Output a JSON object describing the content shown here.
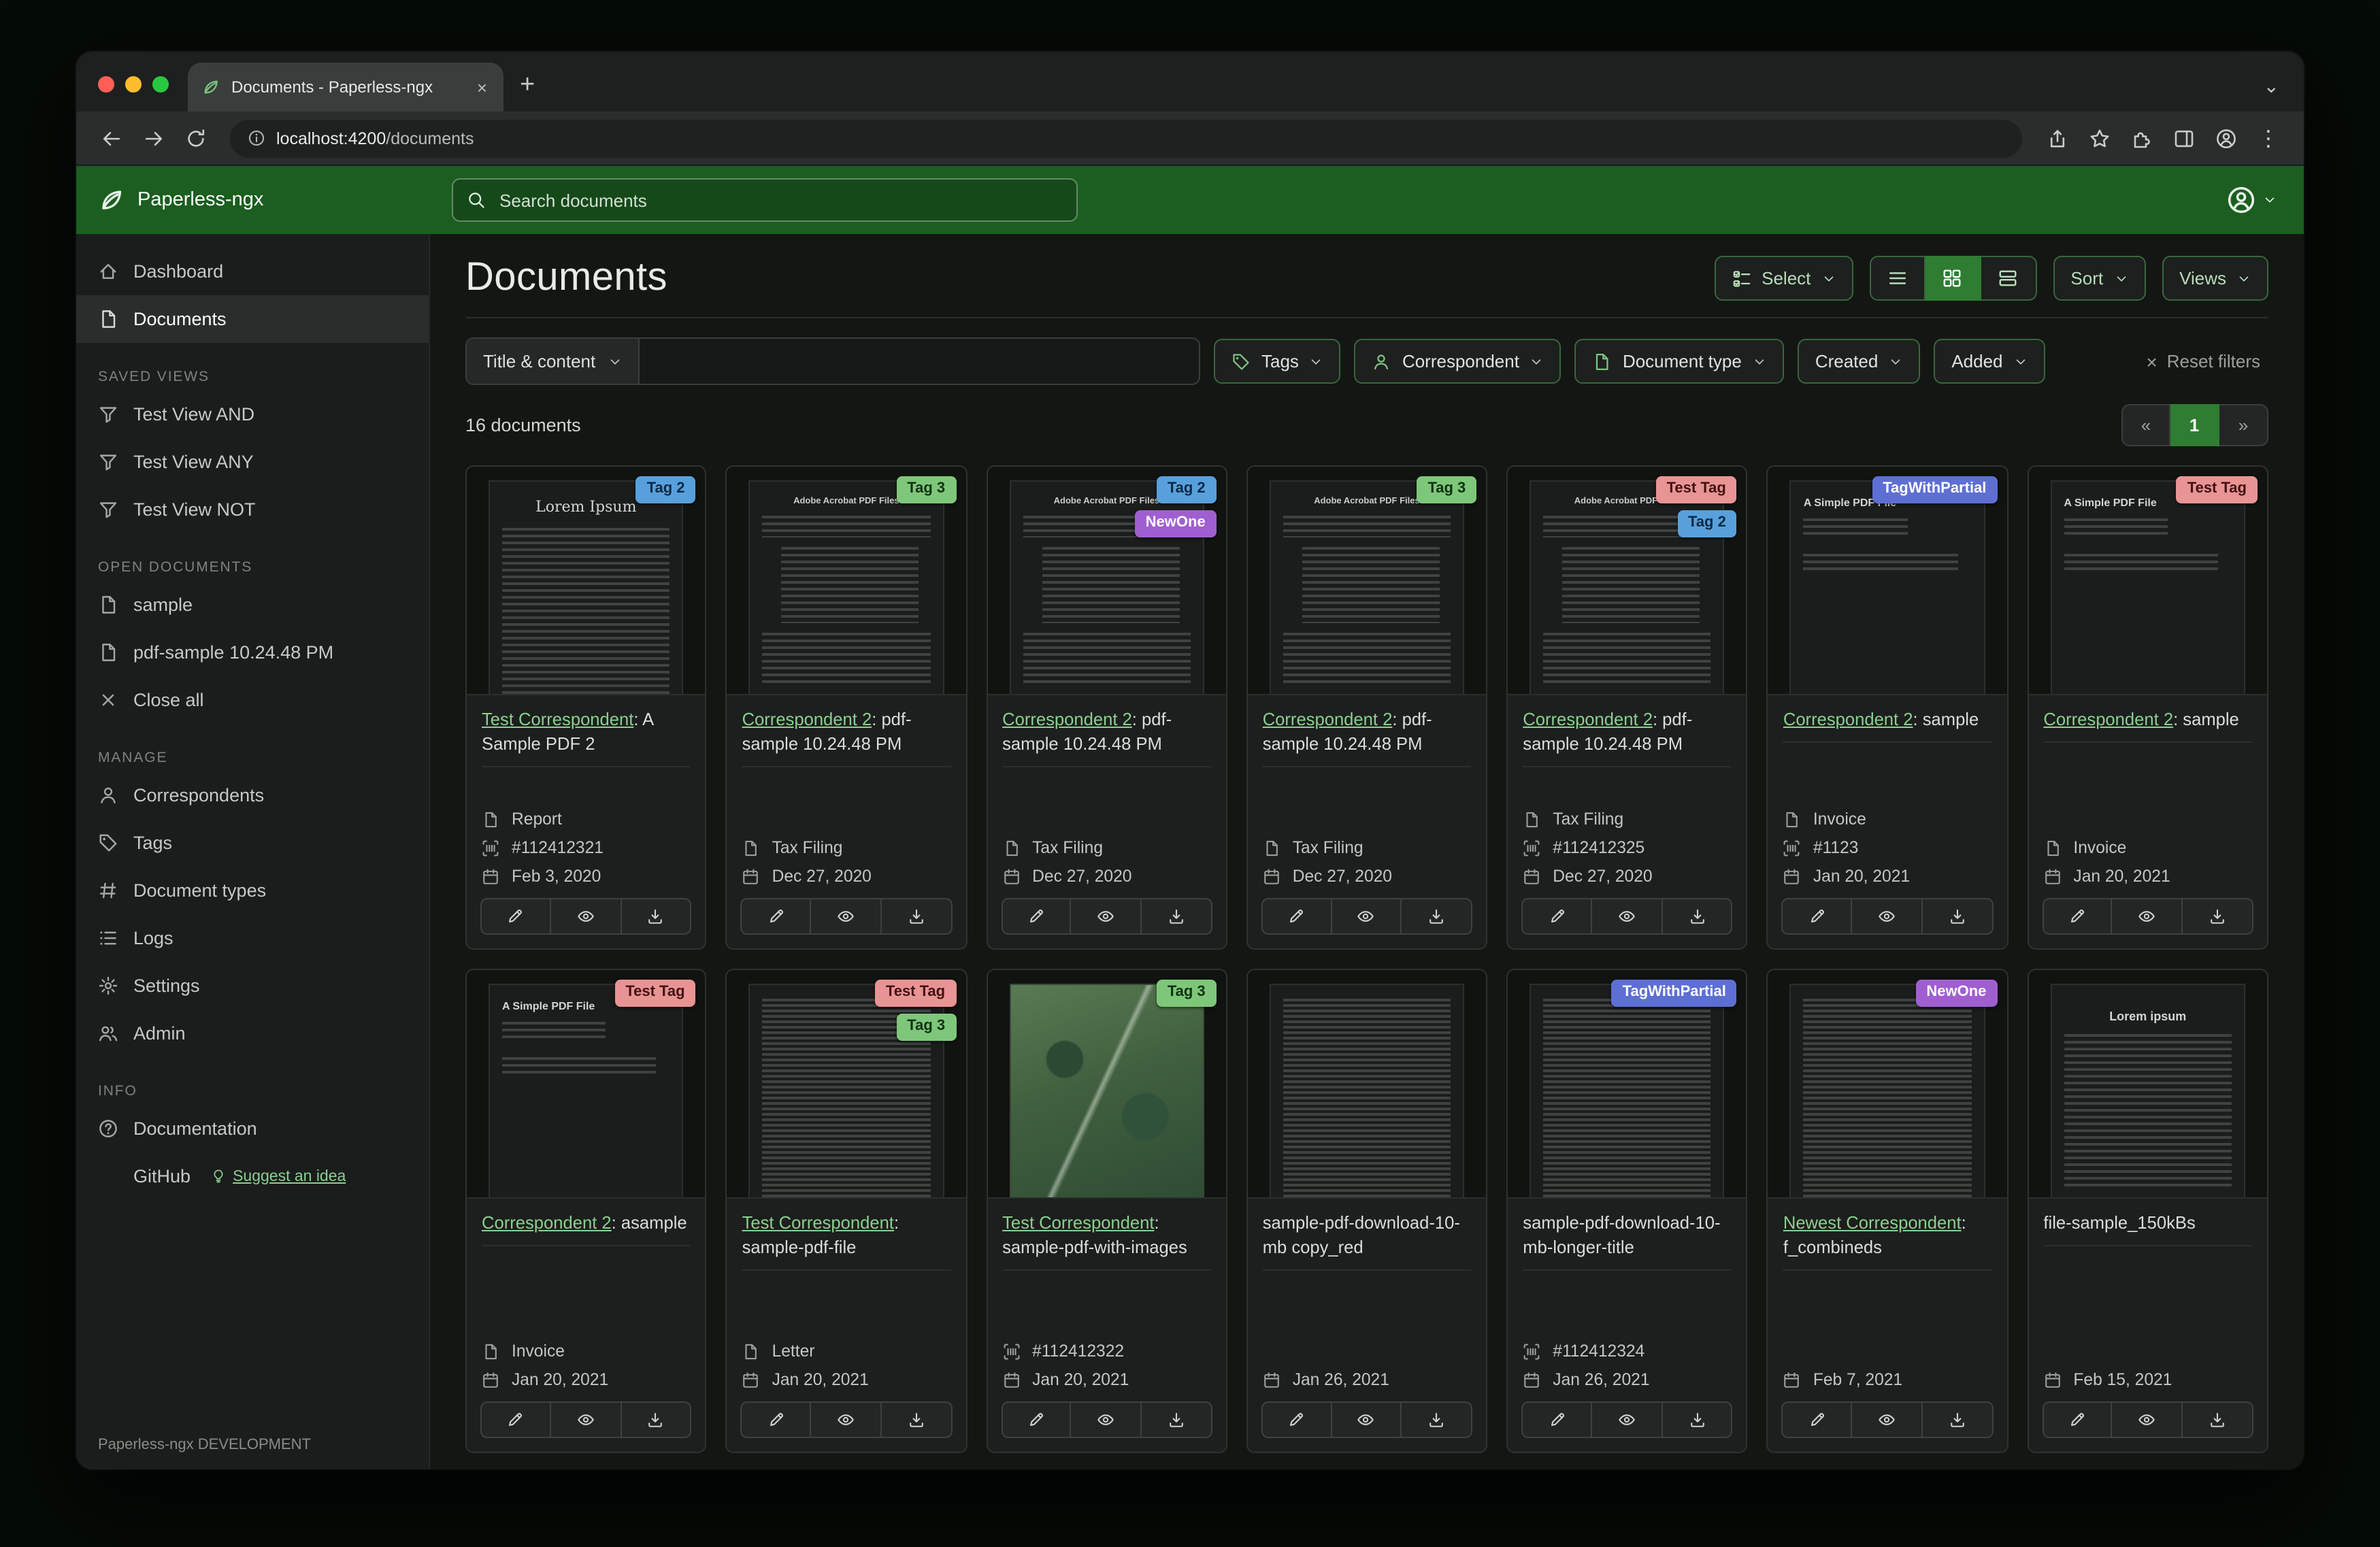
{
  "glyphs": {
    "close": "×",
    "plus": "+",
    "kebab": "⋮",
    "chevron": "⌄"
  },
  "colors": {
    "navbar": "#1b5e20",
    "accent": "#2e7d32",
    "link": "#8ad08f"
  },
  "browser": {
    "tab_title": "Documents - Paperless-ngx",
    "url_host": "localhost:4200",
    "url_path": "/documents"
  },
  "navbar": {
    "brand": "Paperless-ngx",
    "search_placeholder": "Search documents"
  },
  "sidebar": {
    "primary": [
      {
        "label": "Dashboard",
        "icon": "dashboard-icon",
        "active": false
      },
      {
        "label": "Documents",
        "icon": "documents-icon",
        "active": true
      }
    ],
    "sections": [
      {
        "label": "SAVED VIEWS",
        "items": [
          {
            "label": "Test View AND",
            "icon": "filter-icon"
          },
          {
            "label": "Test View ANY",
            "icon": "filter-icon"
          },
          {
            "label": "Test View NOT",
            "icon": "filter-icon"
          }
        ]
      },
      {
        "label": "OPEN DOCUMENTS",
        "items": [
          {
            "label": "sample",
            "icon": "file-icon"
          },
          {
            "label": "pdf-sample 10.24.48 PM",
            "icon": "file-icon"
          },
          {
            "label": "Close all",
            "icon": "close-icon"
          }
        ]
      },
      {
        "label": "MANAGE",
        "items": [
          {
            "label": "Correspondents",
            "icon": "person-icon"
          },
          {
            "label": "Tags",
            "icon": "tag-icon"
          },
          {
            "label": "Document types",
            "icon": "hash-icon"
          },
          {
            "label": "Logs",
            "icon": "logs-icon"
          },
          {
            "label": "Settings",
            "icon": "gear-icon"
          },
          {
            "label": "Admin",
            "icon": "users-icon"
          }
        ]
      },
      {
        "label": "INFO",
        "items": [
          {
            "label": "Documentation",
            "icon": "question-icon"
          },
          {
            "label": "GitHub",
            "icon": "github-icon",
            "extra": "Suggest an idea",
            "extra_icon": "lightbulb-icon"
          }
        ]
      }
    ],
    "footer": "Paperless-ngx DEVELOPMENT"
  },
  "toolbar": {
    "title": "Documents",
    "select_label": "Select",
    "sort_label": "Sort",
    "views_label": "Views"
  },
  "filters": {
    "field_label": "Title & content",
    "input_value": "",
    "buttons": [
      {
        "label": "Tags",
        "icon": "tag-icon"
      },
      {
        "label": "Correspondent",
        "icon": "person-icon"
      },
      {
        "label": "Document type",
        "icon": "file-icon"
      },
      {
        "label": "Created",
        "icon": null
      },
      {
        "label": "Added",
        "icon": null
      }
    ],
    "reset_label": "Reset filters"
  },
  "results": {
    "count_label": "16 documents",
    "pagination": {
      "prev": "«",
      "page": "1",
      "next": "»"
    }
  },
  "tag_colors": {
    "blue": {
      "bg": "#58a0dc",
      "fg": "#0a2a45"
    },
    "green": {
      "bg": "#7ec77a",
      "fg": "#0f3212"
    },
    "red": {
      "bg": "#e89494",
      "fg": "#431111"
    },
    "purple": {
      "bg": "#a05fd0",
      "fg": "#ffffff"
    },
    "indigo": {
      "bg": "#5e6fd3",
      "fg": "#ffffff"
    }
  },
  "cards": [
    {
      "thumb": "lorem",
      "thumb_heading": "Lorem Ipsum",
      "tags": [
        {
          "label": "Tag 2",
          "color": "blue"
        }
      ],
      "link": "Test Correspondent",
      "rest": ": A Sample PDF 2",
      "type": "Report",
      "asn": "#112412321",
      "date": "Feb 3, 2020"
    },
    {
      "thumb": "acrobat",
      "thumb_heading": "Adobe Acrobat PDF Files",
      "tags": [
        {
          "label": "Tag 3",
          "color": "green"
        }
      ],
      "link": "Correspondent 2",
      "rest": ": pdf-sample 10.24.48 PM",
      "type": "Tax Filing",
      "asn": null,
      "date": "Dec 27, 2020"
    },
    {
      "thumb": "acrobat",
      "thumb_heading": "Adobe Acrobat PDF Files",
      "tags": [
        {
          "label": "Tag 2",
          "color": "blue"
        },
        {
          "label": "NewOne",
          "color": "purple"
        }
      ],
      "link": "Correspondent 2",
      "rest": ": pdf-sample 10.24.48 PM",
      "type": "Tax Filing",
      "asn": null,
      "date": "Dec 27, 2020"
    },
    {
      "thumb": "acrobat",
      "thumb_heading": "Adobe Acrobat PDF Files",
      "tags": [
        {
          "label": "Tag 3",
          "color": "green"
        }
      ],
      "link": "Correspondent 2",
      "rest": ": pdf-sample 10.24.48 PM",
      "type": "Tax Filing",
      "asn": null,
      "date": "Dec 27, 2020"
    },
    {
      "thumb": "acrobat",
      "thumb_heading": "Adobe Acrobat PDF Files",
      "tags": [
        {
          "label": "Test Tag",
          "color": "red"
        },
        {
          "label": "Tag 2",
          "color": "blue"
        }
      ],
      "link": "Correspondent 2",
      "rest": ": pdf-sample 10.24.48 PM",
      "type": "Tax Filing",
      "asn": "#112412325",
      "date": "Dec 27, 2020"
    },
    {
      "thumb": "simple",
      "thumb_heading": "A Simple PDF File",
      "tags": [
        {
          "label": "TagWithPartial",
          "color": "indigo"
        }
      ],
      "link": "Correspondent 2",
      "rest": ": sample",
      "type": "Invoice",
      "asn": "#1123",
      "date": "Jan 20, 2021"
    },
    {
      "thumb": "simple",
      "thumb_heading": "A Simple PDF File",
      "tags": [
        {
          "label": "Test Tag",
          "color": "red"
        }
      ],
      "link": "Correspondent 2",
      "rest": ": sample",
      "type": "Invoice",
      "asn": null,
      "date": "Jan 20, 2021"
    },
    {
      "thumb": "simple",
      "thumb_heading": "A Simple PDF File",
      "tags": [
        {
          "label": "Test Tag",
          "color": "red"
        }
      ],
      "link": "Correspondent 2",
      "rest": ": asample",
      "type": "Invoice",
      "asn": null,
      "date": "Jan 20, 2021"
    },
    {
      "thumb": "dense",
      "thumb_heading": null,
      "tags": [
        {
          "label": "Test Tag",
          "color": "red"
        },
        {
          "label": "Tag 3",
          "color": "green"
        }
      ],
      "link": "Test Correspondent",
      "rest": ": sample-pdf-file",
      "type": "Letter",
      "asn": null,
      "date": "Jan 20, 2021"
    },
    {
      "thumb": "map",
      "thumb_heading": null,
      "tags": [
        {
          "label": "Tag 3",
          "color": "green"
        }
      ],
      "link": "Test Correspondent",
      "rest": ": sample-pdf-with-images",
      "type": null,
      "asn": "#112412322",
      "date": "Jan 20, 2021"
    },
    {
      "thumb": "dense",
      "thumb_heading": null,
      "tags": [],
      "link": null,
      "rest": "sample-pdf-download-10-mb copy_red",
      "type": null,
      "asn": null,
      "date": "Jan 26, 2021"
    },
    {
      "thumb": "dense",
      "thumb_heading": null,
      "tags": [
        {
          "label": "TagWithPartial",
          "color": "indigo"
        }
      ],
      "link": null,
      "rest": "sample-pdf-download-10-mb-longer-title",
      "type": null,
      "asn": "#112412324",
      "date": "Jan 26, 2021"
    },
    {
      "thumb": "dense",
      "thumb_heading": null,
      "tags": [
        {
          "label": "NewOne",
          "color": "purple"
        }
      ],
      "link": "Newest Correspondent",
      "rest": ": f_combineds",
      "type": null,
      "asn": null,
      "date": "Feb 7, 2021"
    },
    {
      "thumb": "lorem-center",
      "thumb_heading": "Lorem ipsum",
      "tags": [],
      "link": null,
      "rest": "file-sample_150kBs",
      "type": null,
      "asn": null,
      "date": "Feb 15, 2021"
    }
  ]
}
